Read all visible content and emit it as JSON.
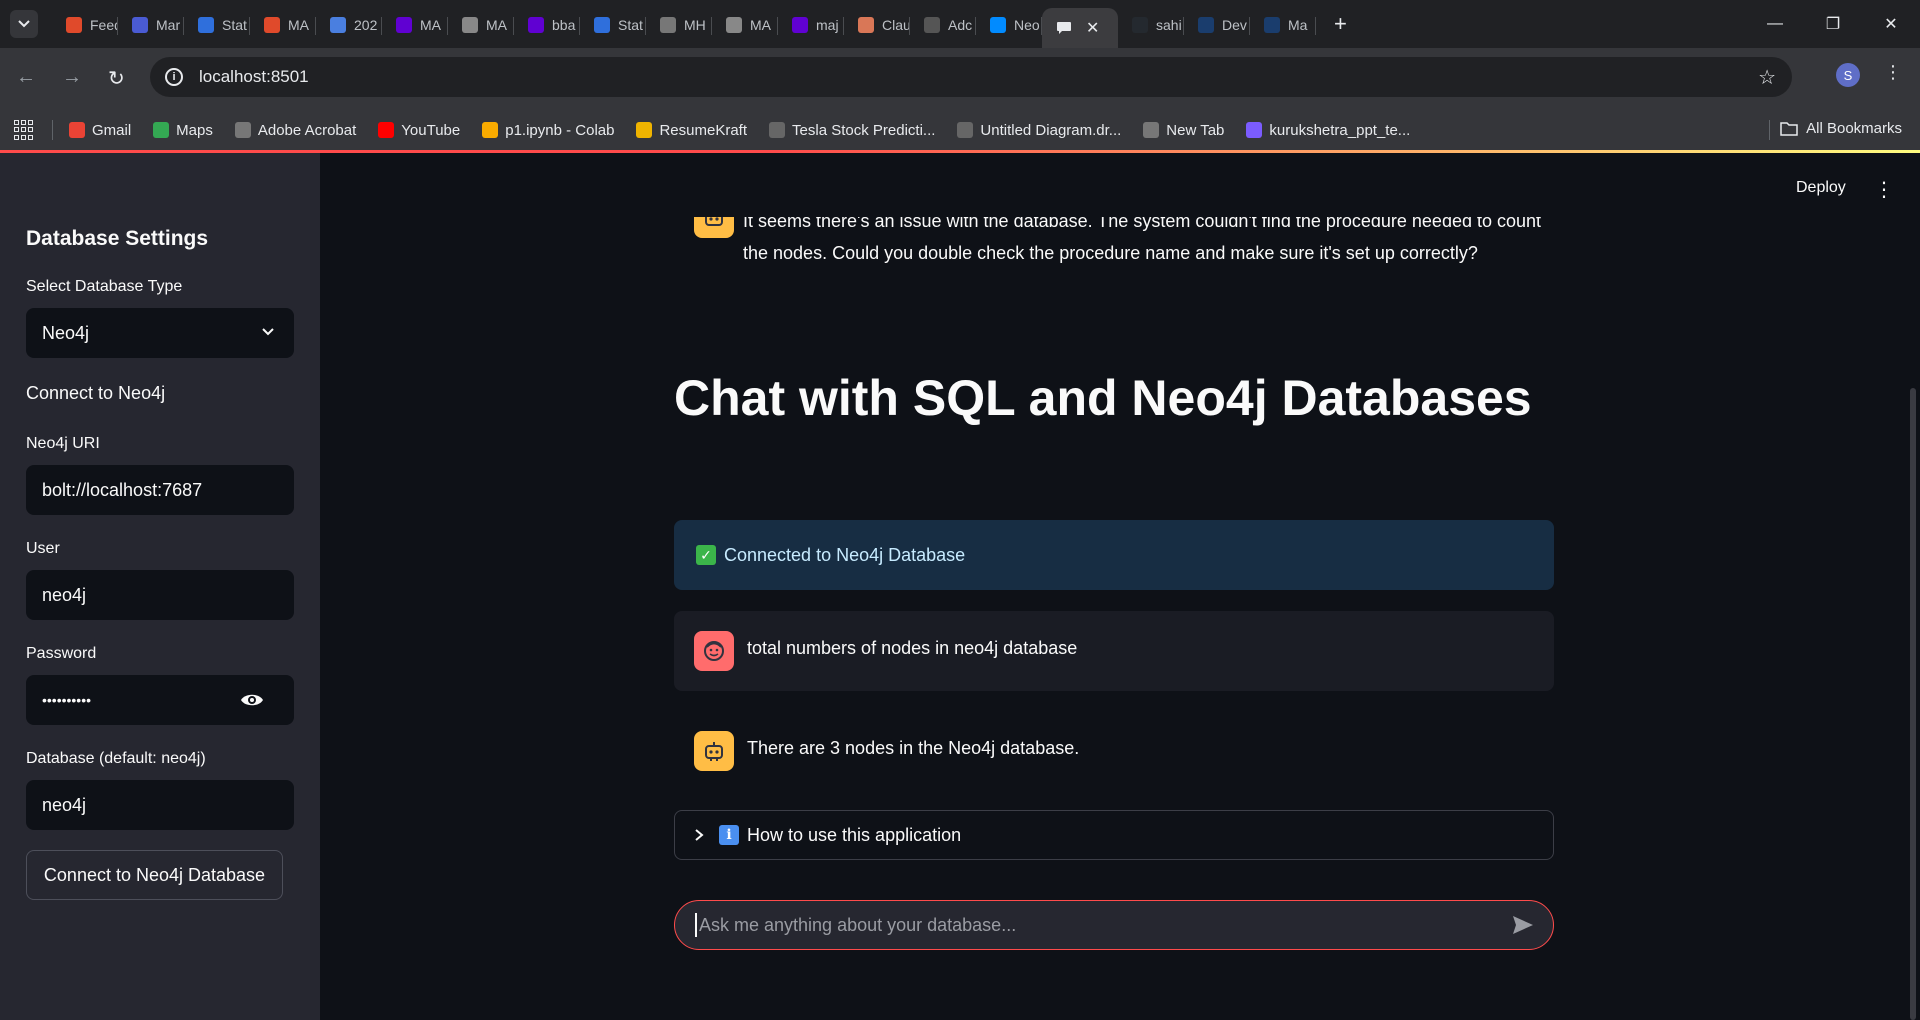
{
  "browser": {
    "tabs": [
      {
        "label": "Feed",
        "color": "#e04a2b"
      },
      {
        "label": "Mar",
        "color": "#4a5bd4"
      },
      {
        "label": "Stat",
        "color": "#2f6fdc"
      },
      {
        "label": "MA",
        "color": "#e04a2b"
      },
      {
        "label": "202",
        "color": "#4a7fe0"
      },
      {
        "label": "MA",
        "color": "#6001d2"
      },
      {
        "label": "MA",
        "color": "#888888"
      },
      {
        "label": "bba",
        "color": "#6001d2"
      },
      {
        "label": "Stat",
        "color": "#2f6fdc"
      },
      {
        "label": "MH",
        "color": "#777777"
      },
      {
        "label": "MA",
        "color": "#888888"
      },
      {
        "label": "maj",
        "color": "#6001d2"
      },
      {
        "label": "Clau",
        "color": "#d97757"
      },
      {
        "label": "Adc",
        "color": "#555555"
      },
      {
        "label": "Neo",
        "color": "#018bff"
      }
    ],
    "active_tab_label": "",
    "tabs_after": [
      {
        "label": "sahi",
        "color": "#24292f"
      },
      {
        "label": "Dev",
        "color": "#1a3d6d"
      },
      {
        "label": "Ma",
        "color": "#1a3d6d"
      }
    ],
    "url": "localhost:8501",
    "profile_initial": "S",
    "bookmarks": [
      {
        "label": "Gmail",
        "color": "#ea4335"
      },
      {
        "label": "Maps",
        "color": "#34a853"
      },
      {
        "label": "Adobe Acrobat",
        "color": "#777777"
      },
      {
        "label": "YouTube",
        "color": "#ff0000"
      },
      {
        "label": "p1.ipynb - Colab",
        "color": "#f9ab00"
      },
      {
        "label": "ResumeKraft",
        "color": "#f0b400"
      },
      {
        "label": "Tesla Stock Predicti...",
        "color": "#666666"
      },
      {
        "label": "Untitled Diagram.dr...",
        "color": "#666666"
      },
      {
        "label": "New Tab",
        "color": "#777777"
      },
      {
        "label": "kurukshetra_ppt_te...",
        "color": "#7b5cff"
      }
    ],
    "all_bookmarks": "All Bookmarks"
  },
  "sidebar": {
    "title": "Database Settings",
    "db_type_label": "Select Database Type",
    "db_type_value": "Neo4j",
    "connect_heading": "Connect to Neo4j",
    "uri_label": "Neo4j URI",
    "uri_value": "bolt://localhost:7687",
    "user_label": "User",
    "user_value": "neo4j",
    "password_label": "Password",
    "password_value": "••••••••••",
    "database_label": "Database (default: neo4j)",
    "database_value": "neo4j",
    "connect_button": "Connect to Neo4j Database"
  },
  "main": {
    "deploy": "Deploy",
    "previous_bot_message": "It seems there's an issue with the database. The system couldn't find the procedure needed to count the nodes. Could you double check the procedure name and make sure it's set up correctly?",
    "title": "Chat with SQL and Neo4j Databases",
    "success_message": "Connected to Neo4j Database",
    "user_message": "total numbers of nodes in neo4j database",
    "bot_message": "There are 3 nodes in the Neo4j database.",
    "expander_label": "How to use this application",
    "chat_placeholder": "Ask me anything about your database..."
  },
  "colors": {
    "accent": "#ff4b4b",
    "bot_avatar": "#ffbd45",
    "user_avatar": "#ff6c6c",
    "success_bg": "#172d43"
  }
}
